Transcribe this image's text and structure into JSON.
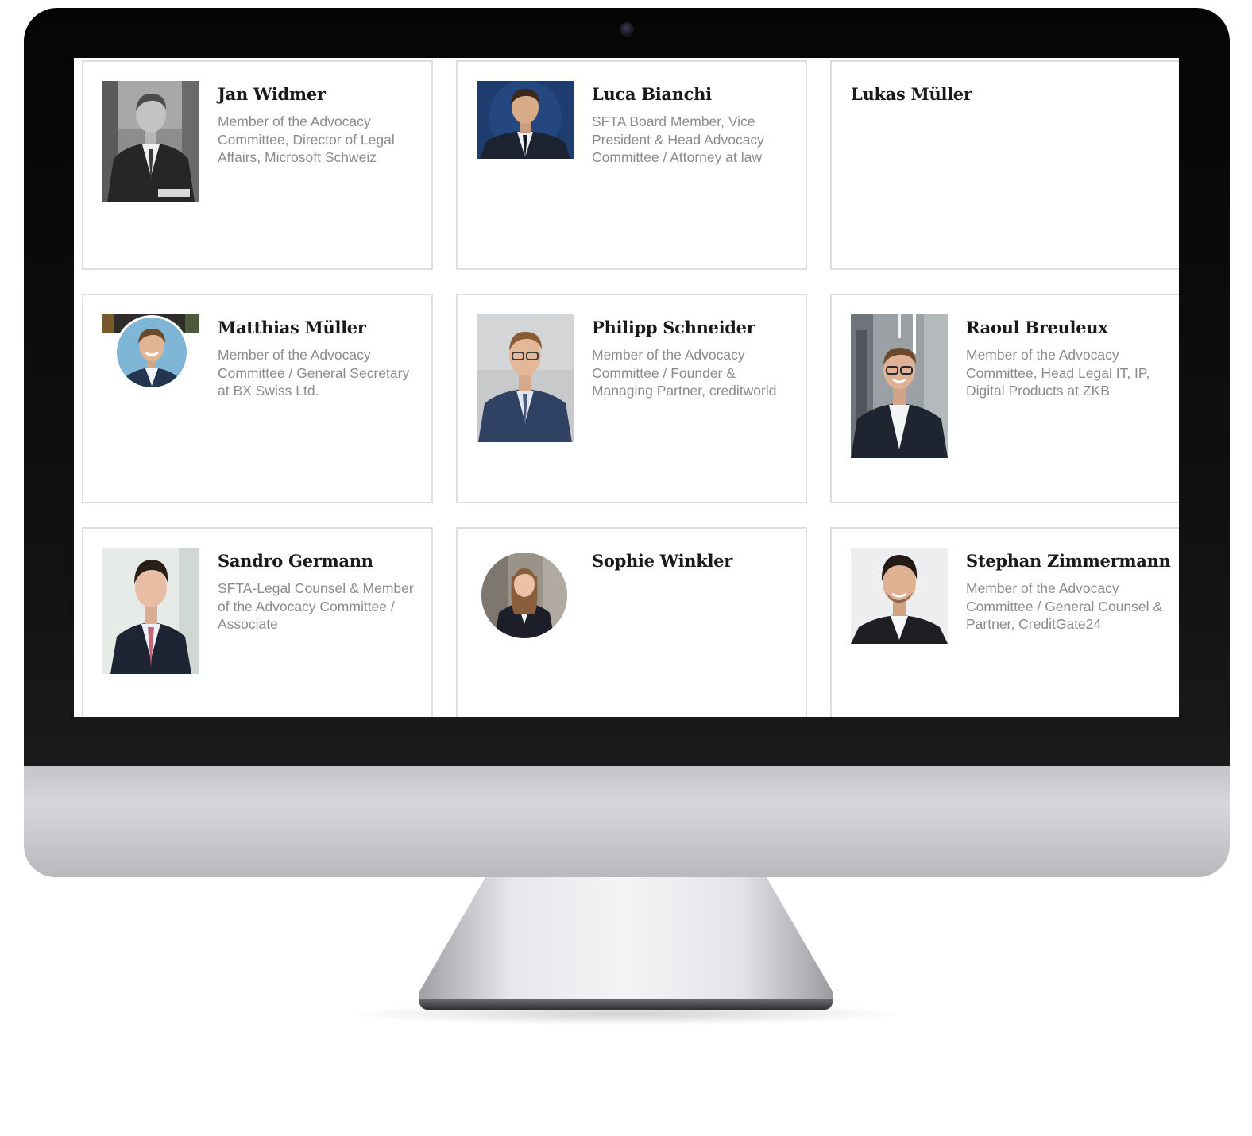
{
  "people": [
    {
      "name": "Jan Widmer",
      "role": "Member of the Advocacy Committee, Director of Legal Affairs, Microsoft Schweiz"
    },
    {
      "name": "Luca Bianchi",
      "role": "SFTA Board Member, Vice President & Head Advocacy Committee / Attorney at law"
    },
    {
      "name": "Lukas Müller",
      "role": ""
    },
    {
      "name": "Matthias Müller",
      "role": "Member of the Advocacy Committee / General Secretary at BX Swiss Ltd."
    },
    {
      "name": "Philipp Schneider",
      "role": "Member of the Advocacy Committee / Founder & Managing Partner, creditworld"
    },
    {
      "name": "Raoul Breuleux",
      "role": "Member of the Advocacy Committee, Head Legal IT, IP, Digital Products at ZKB"
    },
    {
      "name": "Sandro Germann",
      "role": "SFTA-Legal Counsel & Member of the Advocacy Committee / Associate"
    },
    {
      "name": "Sophie Winkler",
      "role": ""
    },
    {
      "name": "Stephan Zimmermann",
      "role": "Member of the Advocacy Committee / General Counsel & Partner, CreditGate24"
    }
  ]
}
